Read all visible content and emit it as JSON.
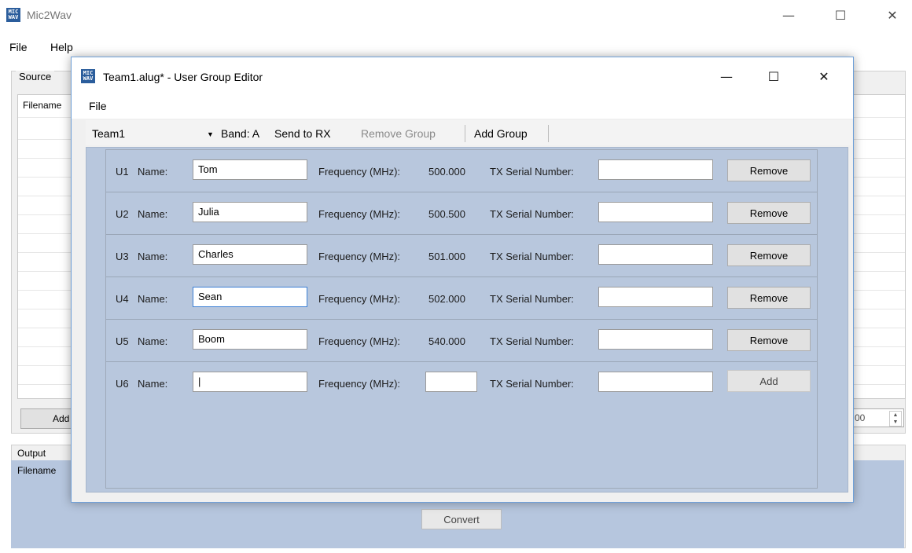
{
  "main": {
    "title": "Mic2Wav",
    "app_icon_text": "MIC WAV",
    "menu": [
      "File",
      "Help"
    ],
    "source_label": "Source",
    "filename_header": "Filename",
    "add_button_label": "Add",
    "spinner_value": "00",
    "output_label": "Output",
    "output_filename_label": "Filename",
    "convert_button_label": "Convert"
  },
  "dialog": {
    "title": "Team1.alug* - User Group Editor",
    "menu": [
      "File"
    ],
    "toolbar": {
      "group": "Team1",
      "band": "Band: A",
      "send_to_rx": "Send to RX",
      "remove_group": "Remove Group",
      "add_group": "Add Group"
    },
    "labels": {
      "name": "Name:",
      "frequency": "Frequency (MHz):",
      "tx_serial": "TX Serial Number:"
    },
    "users": [
      {
        "id": "U1",
        "name": "Tom",
        "frequency": "500.000",
        "tx_serial": "",
        "action": "Remove"
      },
      {
        "id": "U2",
        "name": "Julia",
        "frequency": "500.500",
        "tx_serial": "",
        "action": "Remove"
      },
      {
        "id": "U3",
        "name": "Charles",
        "frequency": "501.000",
        "tx_serial": "",
        "action": "Remove"
      },
      {
        "id": "U4",
        "name": "Sean",
        "frequency": "502.000",
        "tx_serial": "",
        "action": "Remove"
      },
      {
        "id": "U5",
        "name": "Boom",
        "frequency": "540.000",
        "tx_serial": "",
        "action": "Remove"
      },
      {
        "id": "U6",
        "name": "|",
        "frequency": "",
        "tx_serial": "",
        "action": "Add"
      }
    ]
  }
}
